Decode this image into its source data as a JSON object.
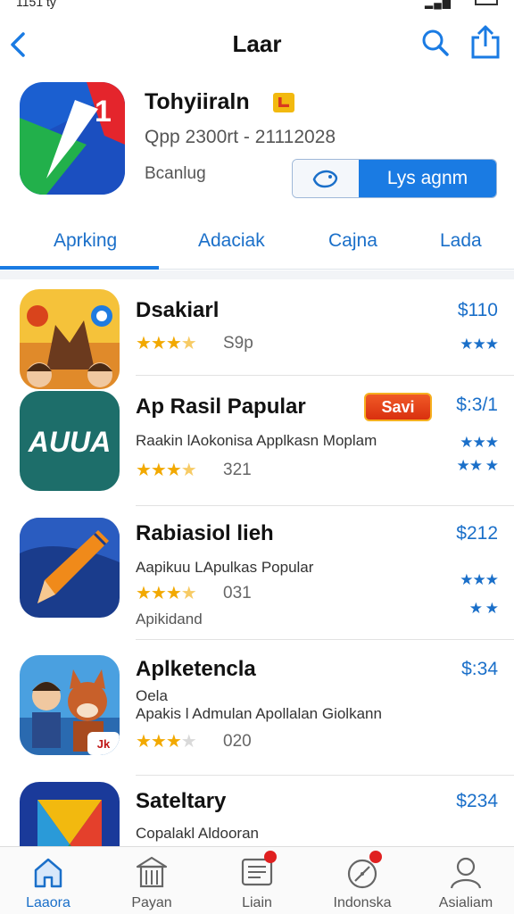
{
  "status": {
    "time": "1151 ty"
  },
  "nav": {
    "title": "Laar"
  },
  "app": {
    "name": "Tohyiiraln",
    "subtitle": "Qpp 2300rt - 21112028",
    "developer": "Bcanlug",
    "get_label": "Lys agnm"
  },
  "tabs": [
    "Aprking",
    "Adaciak",
    "Cajna",
    "Lada"
  ],
  "list": [
    {
      "title": "Dsakiarl",
      "desc": "",
      "desc2": "",
      "rating": 3.5,
      "count": "S9p",
      "price": "$110",
      "side_stars": "★★★",
      "side_stars2": ""
    },
    {
      "title": "Ap Rasil Papular",
      "badge": "Savi",
      "desc": "Raakin lAokonisa Applkasn Moplam",
      "desc2": "",
      "rating": 3.5,
      "count": "321",
      "price": "$:3/1",
      "side_stars": "★★★",
      "side_stars2": "★★ ★"
    },
    {
      "title": "Rabiasiol lieh",
      "desc": "Aapikuu LApulkas Popular",
      "desc2": "Apikidand",
      "rating": 3.5,
      "count": "031",
      "price": "$212",
      "side_stars": "★★★",
      "side_stars2": "★ ★"
    },
    {
      "title": "Aplketencla",
      "desc": "Oela",
      "desc2": "Apakis l Admulan Apollalan Giolkann",
      "rating": 2.5,
      "count": "020",
      "price": "$:34",
      "side_stars": "",
      "side_stars2": ""
    },
    {
      "title": "Sateltary",
      "desc": "Copalakl Aldooran",
      "desc2": "",
      "rating": 0,
      "count": "",
      "price": "$234",
      "side_stars": "",
      "side_stars2": ""
    }
  ],
  "tabbar": [
    {
      "label": "Laaora",
      "icon": "home-icon"
    },
    {
      "label": "Payan",
      "icon": "building-icon"
    },
    {
      "label": "Liain",
      "icon": "list-icon"
    },
    {
      "label": "Indonska",
      "icon": "compass-icon"
    },
    {
      "label": "Asialiam",
      "icon": "person-icon"
    }
  ],
  "colors": {
    "accent": "#1a7be3",
    "star": "#f2a900",
    "badge": "#e8421a"
  }
}
